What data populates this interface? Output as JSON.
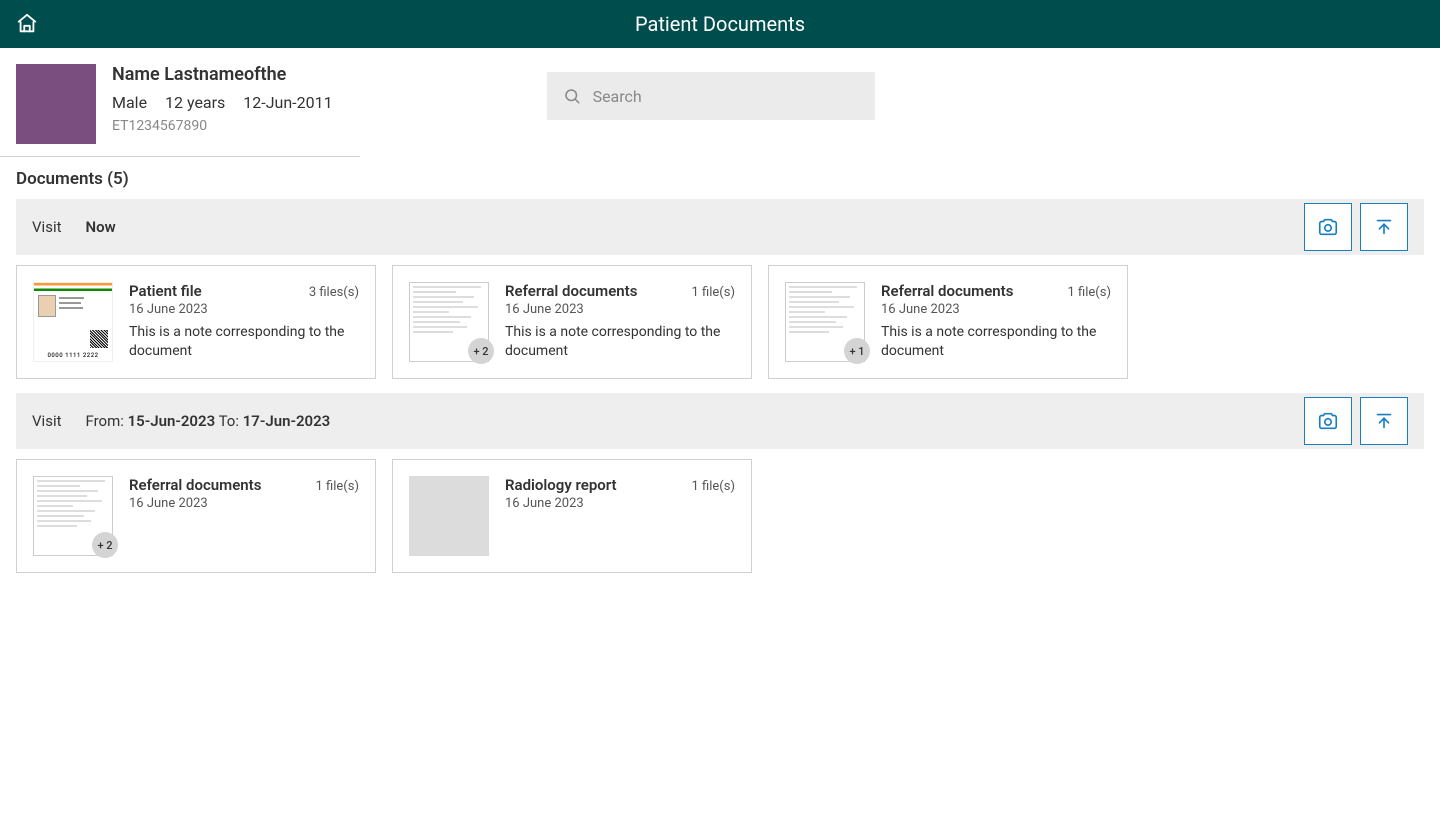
{
  "header": {
    "title": "Patient Documents"
  },
  "patient": {
    "name": "Name Lastnameofthe",
    "sex": "Male",
    "age": "12 years",
    "dob": "12-Jun-2011",
    "id": "ET1234567890"
  },
  "search": {
    "placeholder": "Search",
    "value": ""
  },
  "documents_heading": "Documents (5)",
  "visits": [
    {
      "label": "Visit",
      "value": "Now",
      "cards": [
        {
          "thumb": "idcard",
          "title": "Patient file",
          "files": "3 files(s)",
          "date": "16 June 2023",
          "note": "This is a note corresponding to the document",
          "id_number": "0000 1111 2222"
        },
        {
          "thumb": "doc",
          "title": "Referral documents",
          "files": "1 file(s)",
          "date": "16 June 2023",
          "note": "This is a note corresponding to the document",
          "extra": "+ 2"
        },
        {
          "thumb": "doc",
          "title": "Referral documents",
          "files": "1 file(s)",
          "date": "16 June 2023",
          "note": "This is a note corresponding to the document",
          "extra": "+ 1"
        }
      ]
    },
    {
      "label": "Visit",
      "range": {
        "from_label": "From: ",
        "from_value": "15-Jun-2023",
        "to_label": "  To: ",
        "to_value": "17-Jun-2023"
      },
      "cards": [
        {
          "thumb": "doc",
          "title": "Referral documents",
          "files": "1 file(s)",
          "date": "16 June 2023",
          "extra": "+ 2"
        },
        {
          "thumb": "blank",
          "title": "Radiology report",
          "files": "1 file(s)",
          "date": "16 June 2023"
        }
      ]
    }
  ]
}
